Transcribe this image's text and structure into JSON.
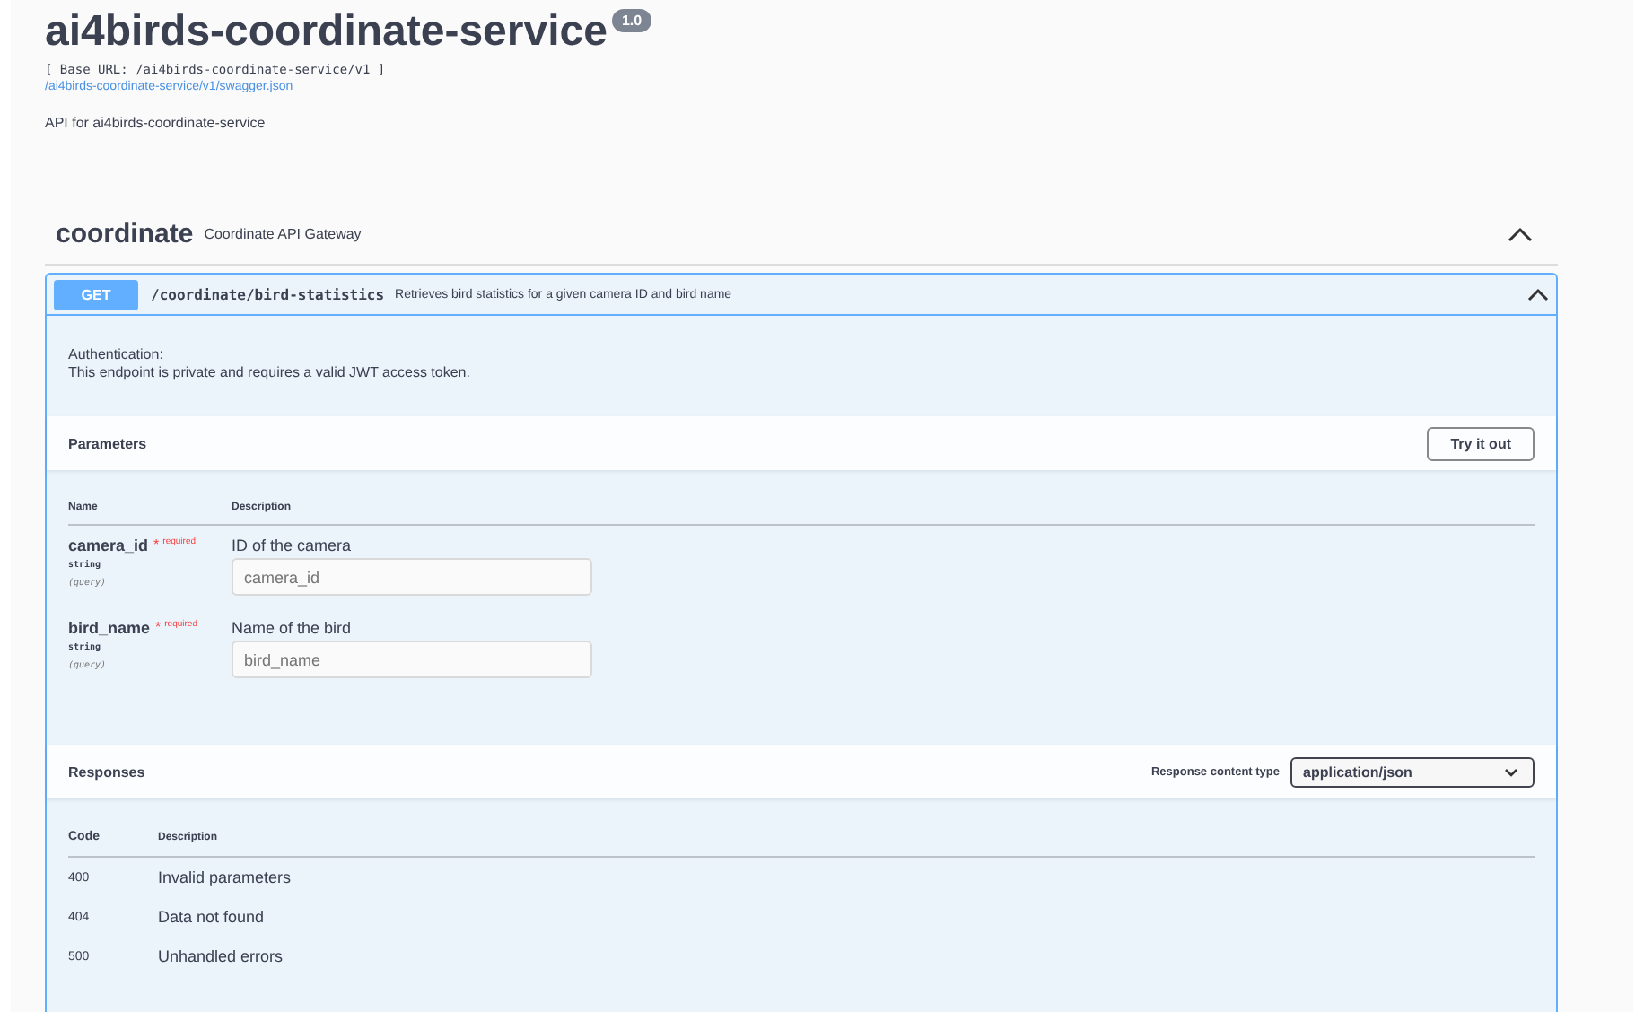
{
  "info": {
    "title": "ai4birds-coordinate-service",
    "version": "1.0",
    "base_url": "[ Base URL: /ai4birds-coordinate-service/v1 ]",
    "spec_link": "/ai4birds-coordinate-service/v1/swagger.json",
    "description": "API for ai4birds-coordinate-service"
  },
  "section": {
    "name": "coordinate",
    "description": "Coordinate API Gateway",
    "expanded": true,
    "operation": {
      "method": "GET",
      "path": "/coordinate/bird-statistics",
      "summary": "Retrieves bird statistics for a given camera ID and bird name",
      "expanded": true,
      "auth_title": "Authentication:",
      "auth_text": "This endpoint is private and requires a valid JWT access token.",
      "parameters_title": "Parameters",
      "try_button": "Try it out",
      "param_columns": [
        "Name",
        "Description"
      ],
      "parameters": [
        {
          "name": "camera_id",
          "required_mark": "*",
          "required_label": "required",
          "type": "string",
          "location": "(query)",
          "description": "ID of the camera",
          "placeholder": "camera_id"
        },
        {
          "name": "bird_name",
          "required_mark": "*",
          "required_label": "required",
          "type": "string",
          "location": "(query)",
          "description": "Name of the bird",
          "placeholder": "bird_name"
        }
      ],
      "responses_title": "Responses",
      "content_type_label": "Response content type",
      "content_type": "application/json",
      "response_columns": [
        "Code",
        "Description"
      ],
      "responses": [
        {
          "code": "400",
          "description": "Invalid parameters"
        },
        {
          "code": "404",
          "description": "Data not found"
        },
        {
          "code": "500",
          "description": "Unhandled errors"
        }
      ]
    }
  }
}
